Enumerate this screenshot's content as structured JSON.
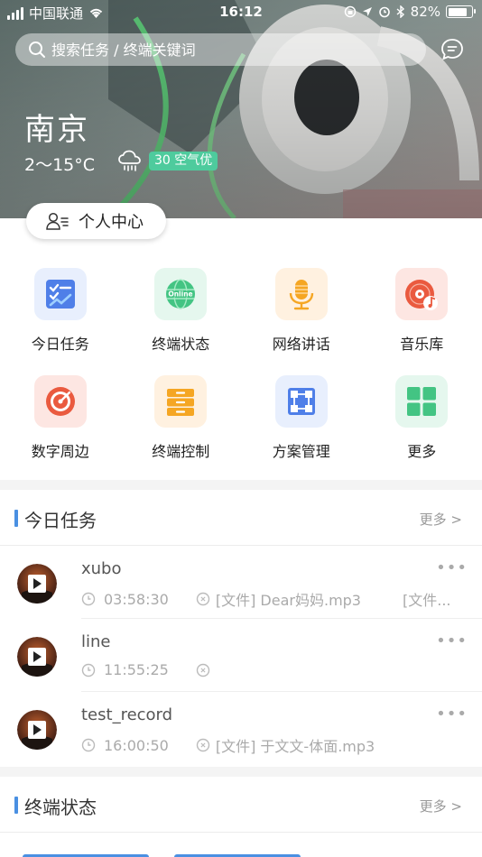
{
  "status_bar": {
    "carrier": "中国联通",
    "time": "16:12",
    "battery": "82%",
    "battery_level": 0.82
  },
  "search": {
    "placeholder": "搜索任务 / 终端关键词"
  },
  "weather": {
    "city": "南京",
    "temp": "2～15°C",
    "aqi": "30 空气优"
  },
  "profile": {
    "label": "个人中心"
  },
  "grid": [
    {
      "label": "今日任务",
      "icon": "task-chart-icon"
    },
    {
      "label": "终端状态",
      "icon": "online-globe-icon"
    },
    {
      "label": "网络讲话",
      "icon": "microphone-icon"
    },
    {
      "label": "音乐库",
      "icon": "music-disc-icon"
    },
    {
      "label": "数字周边",
      "icon": "target-icon"
    },
    {
      "label": "终端控制",
      "icon": "cabinet-icon"
    },
    {
      "label": "方案管理",
      "icon": "plan-nodes-icon"
    },
    {
      "label": "更多",
      "icon": "grid-more-icon"
    }
  ],
  "tasks_section": {
    "title": "今日任务",
    "more": "更多 >",
    "items": [
      {
        "name": "xubo",
        "time": "03:58:30",
        "files": "[文件] Dear妈妈.mp3",
        "extra": "[文件..."
      },
      {
        "name": "line",
        "time": "11:55:25",
        "files": "",
        "extra": ""
      },
      {
        "name": "test_record",
        "time": "16:00:50",
        "files": "[文件] 于文文-体面.mp3",
        "extra": ""
      }
    ]
  },
  "terminal_section": {
    "title": "终端状态",
    "more": "更多 >"
  },
  "colors": {
    "accent": "#4a90e2",
    "aqi": "#4ecb9d"
  }
}
